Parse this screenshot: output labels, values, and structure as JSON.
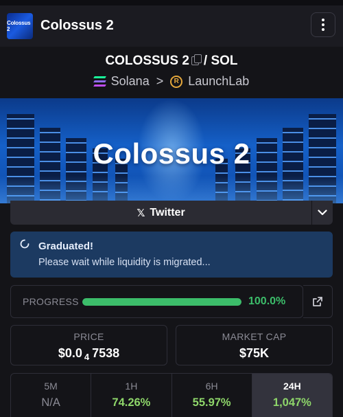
{
  "header": {
    "logo_text": "Colossus 2",
    "title": "Colossus 2",
    "menu_icon": "vertical-dots-icon"
  },
  "token": {
    "name": "COLOSSUS 2",
    "separator": "/",
    "quote": "SOL",
    "chain": "Solana",
    "chevron": ">",
    "launchpad": "LaunchLab",
    "launchpad_icon_letter": "R"
  },
  "banner": {
    "title": "Colossus 2"
  },
  "twitter": {
    "icon": "x-logo-icon",
    "label": "Twitter"
  },
  "notice": {
    "title": "Graduated!",
    "message": "Please wait while liquidity is migrated..."
  },
  "progress": {
    "label": "PROGRESS",
    "percent_text": "100.0%",
    "percent_value": 100,
    "color": "#3cbd6a"
  },
  "price": {
    "label": "PRICE",
    "prefix": "$0.0",
    "zeros_subscript": "4",
    "digits": "7538"
  },
  "market_cap": {
    "label": "MARKET CAP",
    "value": "$75K"
  },
  "timeframes": [
    {
      "label": "5M",
      "value": "N/A",
      "state": "na"
    },
    {
      "label": "1H",
      "value": "74.26%",
      "state": "pos"
    },
    {
      "label": "6H",
      "value": "55.97%",
      "state": "pos"
    },
    {
      "label": "24H",
      "value": "1,047%",
      "state": "pos",
      "active": true
    }
  ],
  "colors": {
    "background": "#141418",
    "positive": "#8ed66a",
    "notice_bg": "#1c3a61"
  }
}
